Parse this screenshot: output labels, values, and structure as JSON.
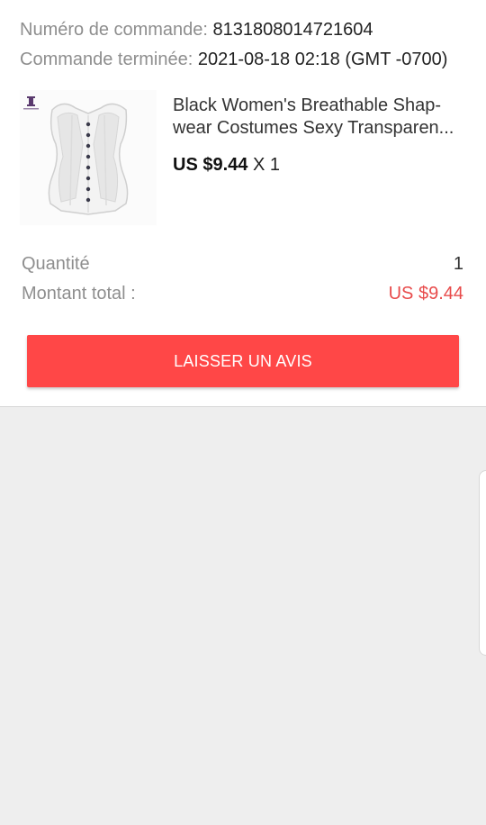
{
  "order": {
    "number_label": "Numéro de commande:",
    "number_value": "8131808014721604",
    "completed_label": "Commande terminée:",
    "completed_value": "2021-08-18 02:18 (GMT -0700)"
  },
  "product": {
    "title": "Black Women's Breathable Shap-wear Costumes Sexy Transparen...",
    "price": "US $9.44",
    "quantity_text": "X 1",
    "image_icon": "white-corset-product-image"
  },
  "summary": {
    "quantity_label": "Quantité",
    "quantity_value": "1",
    "total_label": "Montant total :",
    "total_value": "US $9.44"
  },
  "actions": {
    "review_label": "LAISSER UN AVIS"
  },
  "colors": {
    "accent": "#ff4747",
    "price_red": "#e84b4b",
    "background": "#eeeeee"
  }
}
